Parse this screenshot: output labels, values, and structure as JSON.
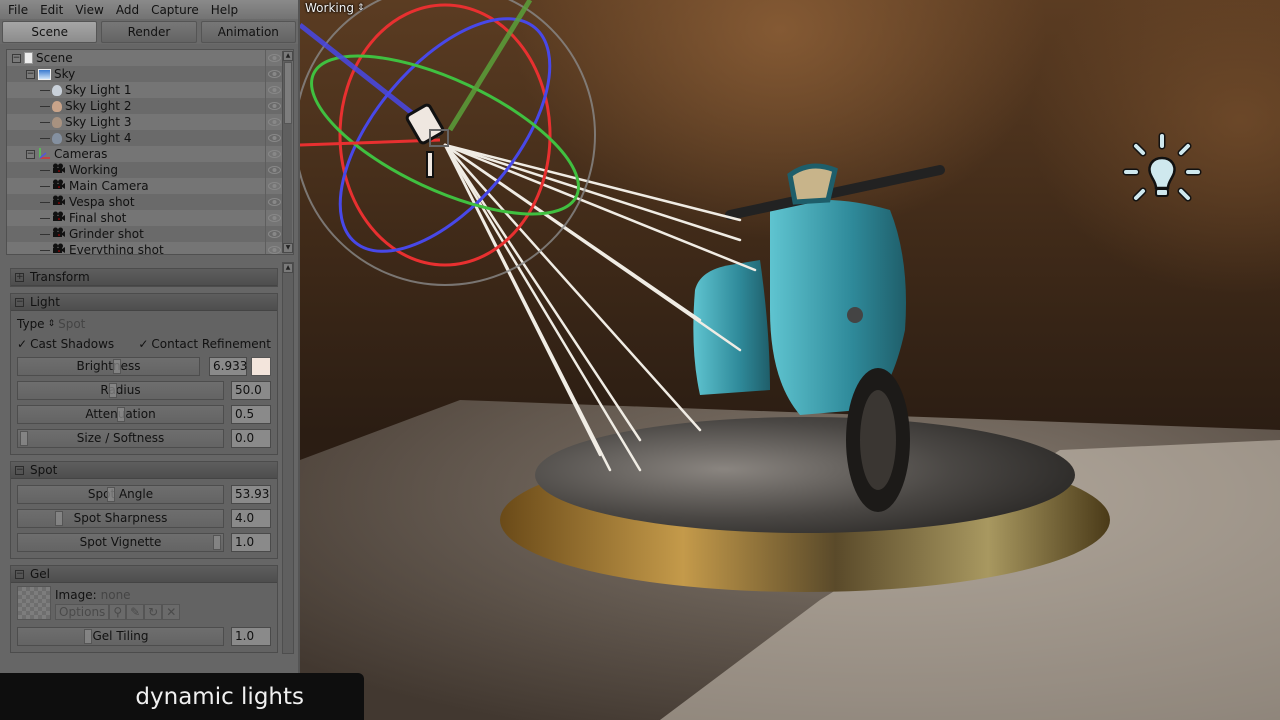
{
  "menubar": {
    "items": [
      "File",
      "Edit",
      "View",
      "Add",
      "Capture",
      "Help"
    ]
  },
  "tabs": [
    {
      "label": "Scene",
      "active": true
    },
    {
      "label": "Render",
      "active": false
    },
    {
      "label": "Animation",
      "active": false
    }
  ],
  "tree": {
    "items": [
      {
        "label": "Scene",
        "icon": "document-icon",
        "level": 0,
        "expander": "minus"
      },
      {
        "label": "Sky",
        "icon": "sky-icon",
        "level": 1,
        "expander": "minus"
      },
      {
        "label": "Sky Light 1",
        "icon": "bulb-icon",
        "level": 2,
        "icon_color": "#c9d1da"
      },
      {
        "label": "Sky Light 2",
        "icon": "bulb-icon",
        "level": 2,
        "icon_color": "#c9a48a"
      },
      {
        "label": "Sky Light 3",
        "icon": "bulb-icon",
        "level": 2,
        "icon_color": "#a89280"
      },
      {
        "label": "Sky Light 4",
        "icon": "bulb-icon",
        "level": 2,
        "icon_color": "#8490a0"
      },
      {
        "label": "Cameras",
        "icon": "axes-icon",
        "level": 1,
        "expander": "minus"
      },
      {
        "label": "Working",
        "icon": "camera-icon",
        "level": 2
      },
      {
        "label": "Main Camera",
        "icon": "camera-icon",
        "level": 2
      },
      {
        "label": "Vespa shot",
        "icon": "camera-icon",
        "level": 2
      },
      {
        "label": "Final shot",
        "icon": "camera-icon",
        "level": 2
      },
      {
        "label": "Grinder shot",
        "icon": "camera-icon",
        "level": 2
      },
      {
        "label": "Everything shot",
        "icon": "camera-icon",
        "level": 2
      }
    ]
  },
  "properties": {
    "transform": {
      "title": "Transform",
      "collapsed": true
    },
    "light": {
      "title": "Light",
      "type_label": "Type",
      "type_value": "Spot",
      "cast_shadows": {
        "label": "Cast Shadows",
        "checked": true
      },
      "contact_refinement": {
        "label": "Contact Refinement",
        "checked": true
      },
      "color": "#f3e5dc",
      "sliders": [
        {
          "label": "Brightness",
          "value": "6.933",
          "fraction": 0.48
        },
        {
          "label": "Radius",
          "value": "50.0",
          "fraction": 0.46
        },
        {
          "label": "Attenuation",
          "value": "0.5",
          "fraction": 0.5
        },
        {
          "label": "Size / Softness",
          "value": "0.0",
          "fraction": 0.0
        }
      ]
    },
    "spot": {
      "title": "Spot",
      "sliders": [
        {
          "label": "Spot Angle",
          "value": "53.93",
          "fraction": 0.45
        },
        {
          "label": "Spot Sharpness",
          "value": "4.0",
          "fraction": 0.18
        },
        {
          "label": "Spot Vignette",
          "value": "1.0",
          "fraction": 1.0
        }
      ]
    },
    "gel": {
      "title": "Gel",
      "image_label": "Image:",
      "image_value": "none",
      "options_label": "Options",
      "tool_icons": [
        "search-icon",
        "pencil-icon",
        "refresh-icon",
        "close-icon"
      ],
      "sliders": [
        {
          "label": "Gel Tiling",
          "value": "1.0",
          "fraction": 0.33
        }
      ]
    }
  },
  "viewport": {
    "camera_label": "Working",
    "gizmo_colors": {
      "x": "#e83030",
      "y": "#40c040",
      "z": "#4848e8",
      "outer": "#8a8a8a"
    },
    "scooter_color": "#3fa3b3"
  },
  "caption": "dynamic lights"
}
